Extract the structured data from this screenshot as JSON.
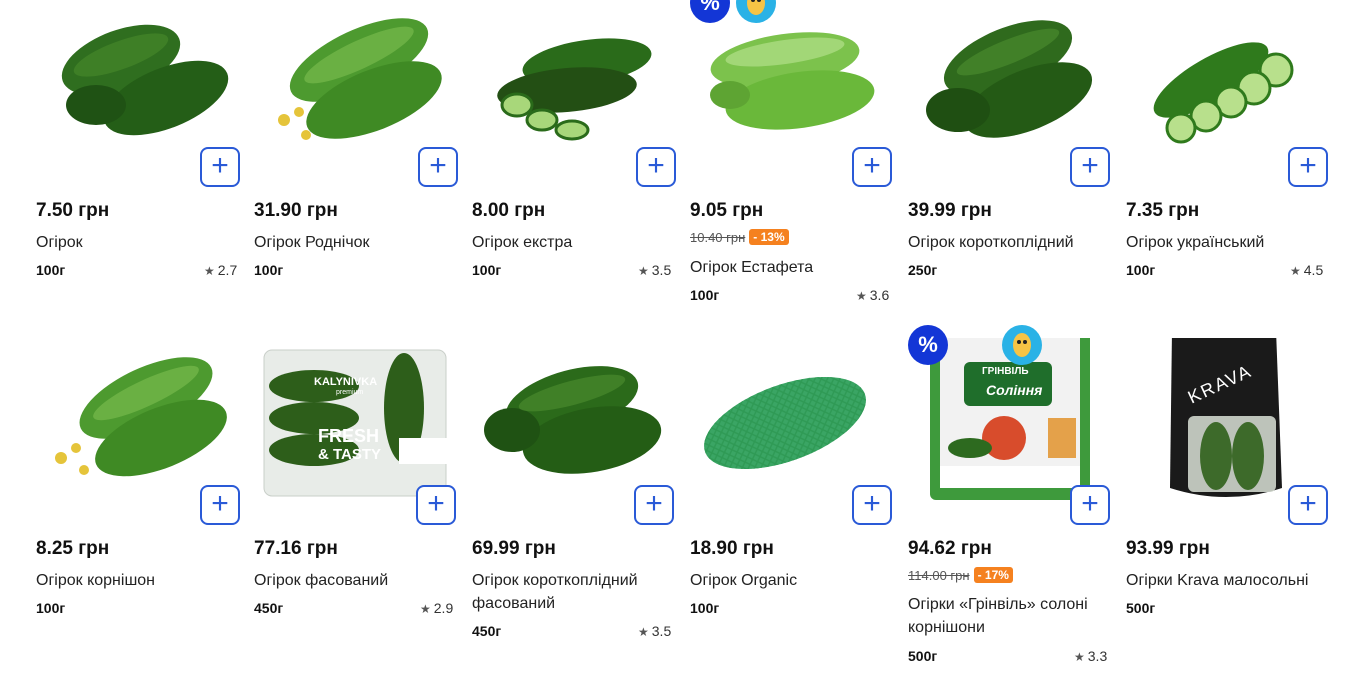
{
  "currency_icon": "plus-icon",
  "colors": {
    "accent": "#2a5ad7",
    "discount": "#f5811f",
    "promo_badge": "#1336d6"
  },
  "products": [
    {
      "price": "7.50 грн",
      "name": "Огірок",
      "weight": "100г",
      "rating": "2.7"
    },
    {
      "price": "31.90 грн",
      "name": "Огірок Роднічок",
      "weight": "100г",
      "rating": ""
    },
    {
      "price": "8.00 грн",
      "name": "Огірок екстра",
      "weight": "100г",
      "rating": "3.5"
    },
    {
      "price": "9.05 грн",
      "old_price": "10.40 грн",
      "discount": "- 13%",
      "name": "Огірок Естафета",
      "weight": "100г",
      "rating": "3.6",
      "badge_pct": "%"
    },
    {
      "price": "39.99 грн",
      "name": "Огірок короткоплідний",
      "weight": "250г",
      "rating": ""
    },
    {
      "price": "7.35 грн",
      "name": "Огірок український",
      "weight": "100г",
      "rating": "4.5"
    },
    {
      "price": "8.25 грн",
      "name": "Огірок корнішон",
      "weight": "100г",
      "rating": ""
    },
    {
      "price": "77.16 грн",
      "name": "Огірок фасований",
      "weight": "450г",
      "rating": "2.9",
      "package_brand": "KALYNIVKA",
      "package_sub": "premium",
      "package_text1": "FRESH",
      "package_text2": "& TASTY"
    },
    {
      "price": "69.99 грн",
      "name": "Огірок короткоплідний фасований",
      "weight": "450г",
      "rating": "3.5"
    },
    {
      "price": "18.90 грн",
      "name": "Огірок Organic",
      "weight": "100г",
      "rating": ""
    },
    {
      "price": "94.62 грн",
      "old_price": "114.00 грн",
      "discount": "- 17%",
      "name": "Огірки «Грінвіль» солоні корнішони",
      "weight": "500г",
      "rating": "3.3",
      "badge_pct": "%",
      "package_brand": "ГРІНВІЛЬ",
      "package_sub": "Соління"
    },
    {
      "price": "93.99 грн",
      "name": "Огірки Krava малосольні",
      "weight": "500г",
      "rating": "",
      "package_brand": "KRAVA"
    }
  ]
}
